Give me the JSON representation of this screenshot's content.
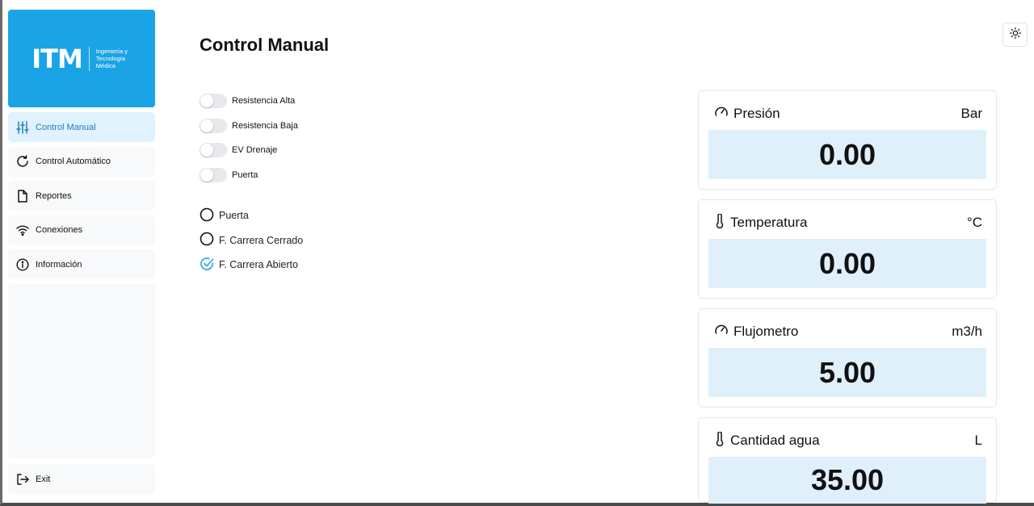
{
  "logo": {
    "text": "ITM",
    "subtitle": "Ingeniería y Tecnología Médica"
  },
  "nav": [
    {
      "label": "Control Manual",
      "icon": "sliders-icon",
      "active": true
    },
    {
      "label": "Control Automático",
      "icon": "refresh-icon",
      "active": false
    },
    {
      "label": "Reportes",
      "icon": "document-icon",
      "active": false
    },
    {
      "label": "Conexiones",
      "icon": "wifi-icon",
      "active": false
    },
    {
      "label": "Información",
      "icon": "info-icon",
      "active": false
    }
  ],
  "exit_label": "Exit",
  "page_title": "Control Manual",
  "toggles": [
    {
      "label": "Resistencia Alta",
      "on": false
    },
    {
      "label": "Resistencia Baja",
      "on": false
    },
    {
      "label": "EV Drenaje",
      "on": false
    },
    {
      "label": "Puerta",
      "on": false
    }
  ],
  "indicators": [
    {
      "label": "Puerta",
      "checked": false
    },
    {
      "label": "F. Carrera Cerrado",
      "checked": false
    },
    {
      "label": "F. Carrera Abierto",
      "checked": true
    }
  ],
  "cards": [
    {
      "name": "Presión",
      "unit": "Bar",
      "value": "0.00",
      "icon": "gauge-icon"
    },
    {
      "name": "Temperatura",
      "unit": "°C",
      "value": "0.00",
      "icon": "thermometer-icon"
    },
    {
      "name": "Flujometro",
      "unit": "m3/h",
      "value": "5.00",
      "icon": "gauge-icon"
    },
    {
      "name": "Cantidad agua",
      "unit": "L",
      "value": "35.00",
      "icon": "thermometer-icon"
    }
  ],
  "colors": {
    "accent": "#1aa4e6",
    "active_bg": "#e0f2fd",
    "value_bg": "#dff0fb",
    "check": "#1aa4e6"
  }
}
